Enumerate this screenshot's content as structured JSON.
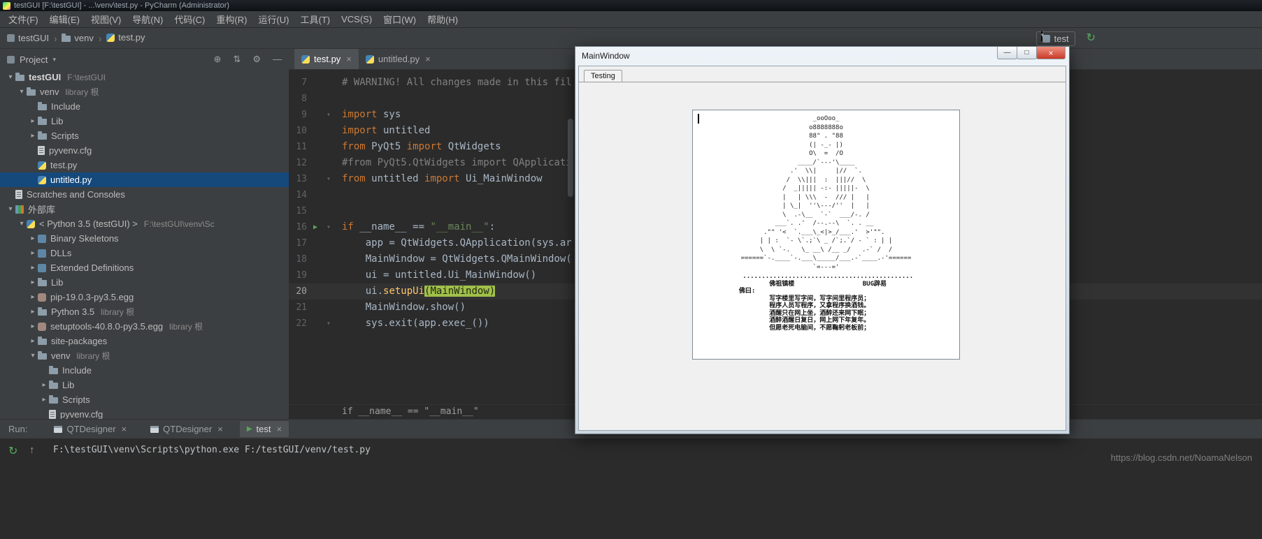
{
  "titlebar": {
    "title": "testGUI [F:\\testGUI] - ...\\venv\\test.py - PyCharm (Administrator)"
  },
  "menu": {
    "items": [
      "文件(F)",
      "编辑(E)",
      "视图(V)",
      "导航(N)",
      "代码(C)",
      "重构(R)",
      "运行(U)",
      "工具(T)",
      "VCS(S)",
      "窗口(W)",
      "帮助(H)"
    ]
  },
  "navbar": {
    "breadcrumb": [
      {
        "label": "testGUI",
        "icon": "project-icon"
      },
      {
        "label": "venv",
        "icon": "folder-icon"
      },
      {
        "label": "test.py",
        "icon": "python-icon"
      }
    ],
    "run_config": {
      "label": "test"
    }
  },
  "project_panel": {
    "title": "Project",
    "tree": [
      {
        "indent": 0,
        "arrow": "down",
        "icon": "folder",
        "label": "testGUI",
        "suffix": "F:\\testGUI",
        "bold": true
      },
      {
        "indent": 1,
        "arrow": "down",
        "icon": "folder",
        "label": "venv",
        "suffix": "library 根"
      },
      {
        "indent": 2,
        "arrow": "none",
        "icon": "folder",
        "label": "Include"
      },
      {
        "indent": 2,
        "arrow": "right",
        "icon": "folder",
        "label": "Lib"
      },
      {
        "indent": 2,
        "arrow": "right",
        "icon": "folder",
        "label": "Scripts"
      },
      {
        "indent": 2,
        "arrow": "none",
        "icon": "config",
        "label": "pyvenv.cfg"
      },
      {
        "indent": 2,
        "arrow": "none",
        "icon": "python",
        "label": "test.py"
      },
      {
        "indent": 2,
        "arrow": "none",
        "icon": "python",
        "label": "untitled.py",
        "selected": true
      },
      {
        "indent": 0,
        "arrow": "none",
        "icon": "scratch",
        "label": "Scratches and Consoles"
      },
      {
        "indent": 0,
        "arrow": "down",
        "icon": "library",
        "label": "外部库"
      },
      {
        "indent": 1,
        "arrow": "down",
        "icon": "python",
        "label": "< Python 3.5 (testGUI) >",
        "suffix": "F:\\testGUI\\venv\\Sc"
      },
      {
        "indent": 2,
        "arrow": "right",
        "icon": "binlib",
        "label": "Binary Skeletons"
      },
      {
        "indent": 2,
        "arrow": "right",
        "icon": "binlib",
        "label": "DLLs"
      },
      {
        "indent": 2,
        "arrow": "right",
        "icon": "binlib",
        "label": "Extended Definitions"
      },
      {
        "indent": 2,
        "arrow": "right",
        "icon": "folder",
        "label": "Lib"
      },
      {
        "indent": 2,
        "arrow": "right",
        "icon": "egg",
        "label": "pip-19.0.3-py3.5.egg"
      },
      {
        "indent": 2,
        "arrow": "right",
        "icon": "folder",
        "label": "Python 3.5",
        "suffix": "library 根"
      },
      {
        "indent": 2,
        "arrow": "right",
        "icon": "egg",
        "label": "setuptools-40.8.0-py3.5.egg",
        "suffix": "library 根"
      },
      {
        "indent": 2,
        "arrow": "right",
        "icon": "folder",
        "label": "site-packages"
      },
      {
        "indent": 2,
        "arrow": "down",
        "icon": "folder",
        "label": "venv",
        "suffix": "library 根"
      },
      {
        "indent": 3,
        "arrow": "none",
        "icon": "folder",
        "label": "Include"
      },
      {
        "indent": 3,
        "arrow": "right",
        "icon": "folder",
        "label": "Lib"
      },
      {
        "indent": 3,
        "arrow": "right",
        "icon": "folder",
        "label": "Scripts"
      },
      {
        "indent": 3,
        "arrow": "none",
        "icon": "config",
        "label": "pyvenv.cfg"
      }
    ]
  },
  "editor": {
    "tabs": [
      {
        "label": "test.py",
        "active": true
      },
      {
        "label": "untitled.py",
        "active": false
      }
    ],
    "lines": [
      {
        "num": 7,
        "segments": [
          [
            "c",
            "# WARNING! All changes made in this fil"
          ]
        ]
      },
      {
        "num": 8,
        "segments": []
      },
      {
        "num": 9,
        "fold": true,
        "segments": [
          [
            "k",
            "import"
          ],
          [
            "n",
            " sys"
          ]
        ]
      },
      {
        "num": 10,
        "segments": [
          [
            "k",
            "import"
          ],
          [
            "n",
            " untitled"
          ]
        ]
      },
      {
        "num": 11,
        "segments": [
          [
            "k",
            "from"
          ],
          [
            "n",
            " PyQt5 "
          ],
          [
            "k",
            "import"
          ],
          [
            "n",
            " QtWidgets"
          ]
        ]
      },
      {
        "num": 12,
        "segments": [
          [
            "c",
            "#from PyQt5.QtWidgets import QApplicati"
          ]
        ]
      },
      {
        "num": 13,
        "fold": true,
        "segments": [
          [
            "k",
            "from"
          ],
          [
            "n",
            " untitled "
          ],
          [
            "k",
            "import"
          ],
          [
            "n",
            " Ui_MainWindow"
          ]
        ]
      },
      {
        "num": 14,
        "segments": []
      },
      {
        "num": 15,
        "segments": []
      },
      {
        "num": 16,
        "run": true,
        "fold": true,
        "segments": [
          [
            "k",
            "if"
          ],
          [
            "n",
            " __name__ == "
          ],
          [
            "s",
            "\"__main__\""
          ],
          [
            "n",
            ":"
          ]
        ]
      },
      {
        "num": 17,
        "segments": [
          [
            "n",
            "    app = QtWidgets.QApplication(sys.ar"
          ]
        ]
      },
      {
        "num": 18,
        "segments": [
          [
            "n",
            "    MainWindow = QtWidgets.QMainWindow("
          ]
        ]
      },
      {
        "num": 19,
        "segments": [
          [
            "n",
            "    ui = untitled.Ui_MainWindow()"
          ]
        ]
      },
      {
        "num": 20,
        "current": true,
        "segments": [
          [
            "n",
            "    ui."
          ],
          [
            "f",
            "setupUi"
          ],
          [
            "hl",
            "(MainWindow)"
          ]
        ]
      },
      {
        "num": 21,
        "segments": [
          [
            "n",
            "    MainWindow.show()"
          ]
        ]
      },
      {
        "num": 22,
        "fold": true,
        "segments": [
          [
            "n",
            "    sys.exit(app.exec_())"
          ]
        ]
      }
    ],
    "breadcrumb_context": "if __name__ == \"__main__\""
  },
  "run_panel": {
    "label": "Run:",
    "tabs": [
      {
        "label": "QTDesigner",
        "icon": "designer",
        "active": false
      },
      {
        "label": "QTDesigner",
        "icon": "designer",
        "active": false
      },
      {
        "label": "test",
        "icon": "run",
        "active": true
      }
    ],
    "console_command": "F:\\testGUI\\venv\\Scripts\\python.exe F:/testGUI/venv/test.py"
  },
  "float_window": {
    "title": "MainWindow",
    "tab_label": "Testing",
    "ascii_art": [
      "                   _ooOoo_",
      "                  o8888888o",
      "                  88\" . \"88",
      "                  (| -_- |)",
      "                  O\\  =  /O",
      "               ____/`---'\\____",
      "             .'  \\\\|     |//  `.",
      "            /  \\\\|||  :  |||//  \\",
      "           /  _||||| -:- |||||-  \\",
      "           |   | \\\\\\  -  /// |   |",
      "           | \\_|  ''\\---/''  |   |",
      "           \\  .-\\__  `-`  ___/-. /",
      "         ___`. .'  /--.--\\  `. . __",
      "      .\"\" '<  `.___\\_<|>_/___.'  >'\"\".",
      "     | | :  `- \\`.;`\\ _ /`;.`/ - ` : | |",
      "     \\  \\ `-.   \\_ __\\ /__ _/   .-` /  /",
      "======`-.____`-.___\\_____/___.-`____.-'======",
      "                   `=---='"
    ],
    "text_lines": [
      " .............................................",
      "        佛祖镇楼                  BUG辟易",
      "佛曰:",
      "        写字楼里写字间，写字间里程序员；",
      "        程序人员写程序，又拿程序换酒钱。",
      "        酒醒只在网上坐，酒醉还来网下眠；",
      "        酒醉酒醒日复日，网上网下年复年。",
      "        但愿老死电脑间，不愿鞠躬老板前；"
    ]
  },
  "watermark": "https://blog.csdn.net/NoamaNelson"
}
